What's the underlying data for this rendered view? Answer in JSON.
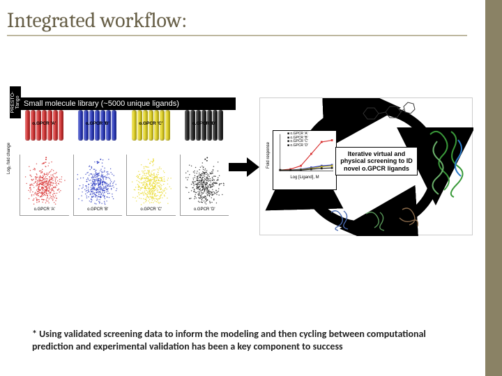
{
  "title": "Integrated workflow:",
  "library_header": "Small molecule library (~5000 unique ligands)",
  "presto_label": "PRESTO-Tango",
  "barrels": [
    {
      "label": "o.GPCR 'A'",
      "color": "#d83030"
    },
    {
      "label": "o.GPCR 'B'",
      "color": "#2838c0"
    },
    {
      "label": "o.GPCR 'C'",
      "color": "#e8d820"
    },
    {
      "label": "o.GPCR 'D'",
      "color": "#202020"
    }
  ],
  "scatter_ylabel": "Log₂ fold change",
  "scatter_xlabels": [
    "o.GPCR 'A'",
    "o.GPCR 'B'",
    "o.GPCR 'C'",
    "o.GPCR 'D'"
  ],
  "cycle_center_text": "Iterative virtual and physical screening to ID novel o.GPCR ligands",
  "curve": {
    "ylabel": "Fold response",
    "xlabel": "Log [Ligand], M",
    "legend": [
      "o.GPCR 'A'",
      "o.GPCR 'B'",
      "o.GPCR 'C'",
      "o.GPCR 'D'"
    ]
  },
  "chart_data": {
    "type": "line",
    "title": "",
    "xlabel": "Log [Ligand], M",
    "ylabel": "Fold response",
    "x": [
      -10,
      -9,
      -8,
      -7,
      -6,
      -5
    ],
    "series": [
      {
        "name": "o.GPCR 'A'",
        "color": "#d83030",
        "values": [
          1,
          2,
          6,
          20,
          34,
          36
        ]
      },
      {
        "name": "o.GPCR 'B'",
        "color": "#2838c0",
        "values": [
          1,
          1,
          2,
          4,
          6,
          7
        ]
      },
      {
        "name": "o.GPCR 'C'",
        "color": "#b0a020",
        "values": [
          1,
          1,
          1.5,
          3,
          5,
          6
        ]
      },
      {
        "name": "o.GPCR 'D'",
        "color": "#202020",
        "values": [
          1,
          1,
          1,
          2,
          3,
          3.5
        ]
      }
    ],
    "ylim": [
      0,
      40
    ]
  },
  "footnote": "* Using validated screening data to inform the modeling and then cycling between computational prediction and experimental validation has been a key component to success"
}
